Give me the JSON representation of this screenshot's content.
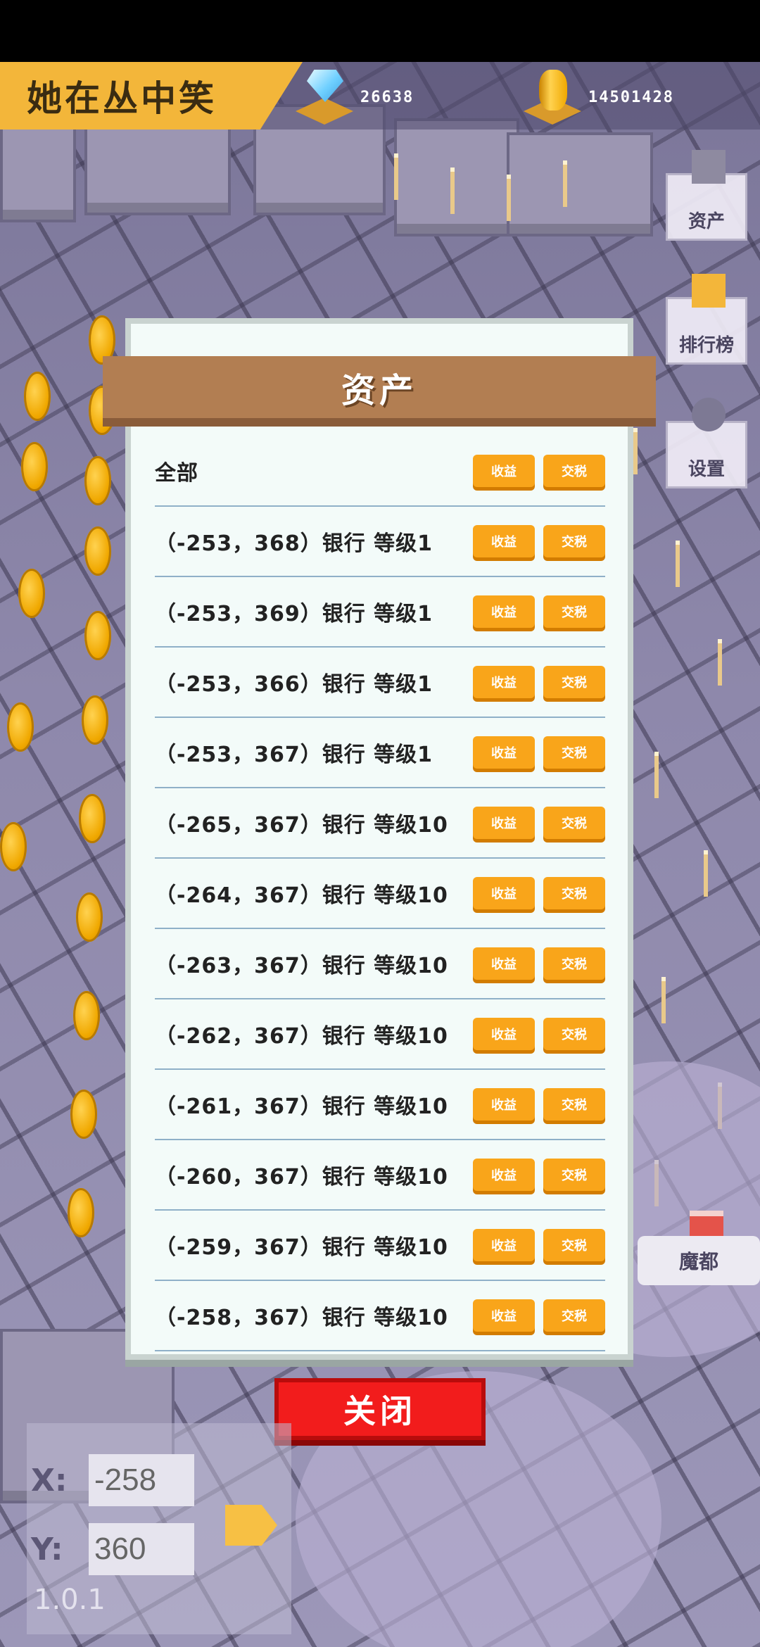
{
  "hud": {
    "title": "她在丛中笑",
    "diamonds": "26638",
    "coins": "14501428"
  },
  "side_buttons": {
    "assets": "资产",
    "ranking": "排行榜",
    "settings": "设置"
  },
  "modal": {
    "title": "资产",
    "collect_label": "收益",
    "tax_label": "交税",
    "rows": [
      {
        "label": "全部"
      },
      {
        "label": "（-253，368）银行 等级1"
      },
      {
        "label": "（-253，369）银行 等级1"
      },
      {
        "label": "（-253，366）银行 等级1"
      },
      {
        "label": "（-253，367）银行 等级1"
      },
      {
        "label": "（-265，367）银行 等级10"
      },
      {
        "label": "（-264，367）银行 等级10"
      },
      {
        "label": "（-263，367）银行 等级10"
      },
      {
        "label": "（-262，367）银行 等级10"
      },
      {
        "label": "（-261，367）银行 等级10"
      },
      {
        "label": "（-260，367）银行 等级10"
      },
      {
        "label": "（-259，367）银行 等级10"
      },
      {
        "label": "（-258，367）银行 等级10"
      }
    ],
    "close_label": "关闭"
  },
  "city_bubble": "魔都",
  "coords": {
    "x_label": "X:",
    "y_label": "Y:",
    "x_value": "-258",
    "y_value": "360"
  },
  "version": "1.0.1",
  "colors": {
    "accent": "#f3b63a",
    "button": "#f9a51a",
    "close": "#f21c1c",
    "banner": "#b27e52"
  }
}
